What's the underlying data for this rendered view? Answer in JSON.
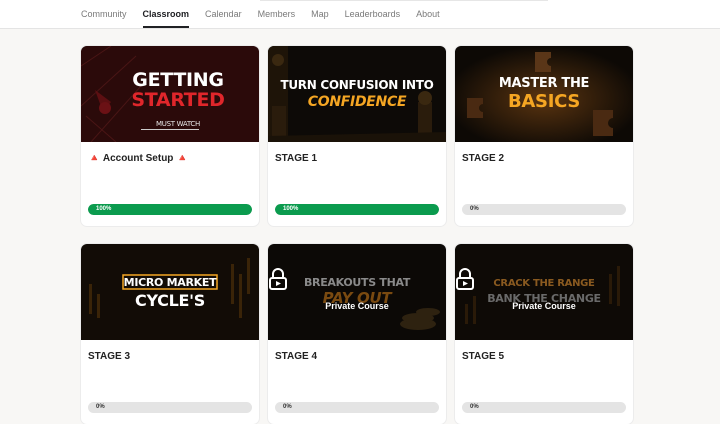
{
  "nav": {
    "items": [
      {
        "label": "Community",
        "active": false
      },
      {
        "label": "Classroom",
        "active": true
      },
      {
        "label": "Calendar",
        "active": false
      },
      {
        "label": "Members",
        "active": false
      },
      {
        "label": "Map",
        "active": false
      },
      {
        "label": "Leaderboards",
        "active": false
      },
      {
        "label": "About",
        "active": false
      }
    ]
  },
  "colors": {
    "progress_fill": "#0b9b4e",
    "progress_track": "#e4e4e4",
    "accent_orange": "#f5a623",
    "accent_red": "#e0262b"
  },
  "courses": [
    {
      "title": "🔺 Account Setup 🔺",
      "progress": 100,
      "progress_label": "100%",
      "locked": false,
      "thumb": {
        "line1": "GETTING",
        "line2": "STARTED",
        "sub": "MUST WATCH"
      }
    },
    {
      "title": "STAGE 1",
      "progress": 100,
      "progress_label": "100%",
      "locked": false,
      "thumb": {
        "line1": "TURN CONFUSION INTO",
        "line2": "CONFIDENCE"
      }
    },
    {
      "title": "STAGE 2",
      "progress": 0,
      "progress_label": "0%",
      "locked": false,
      "thumb": {
        "line1": "MASTER THE",
        "line2": "BASICS"
      }
    },
    {
      "title": "STAGE 3",
      "progress": 0,
      "progress_label": "0%",
      "locked": false,
      "thumb": {
        "line1": "MICRO MARKET",
        "line2": "CYCLE'S"
      }
    },
    {
      "title": "STAGE 4",
      "progress": 0,
      "progress_label": "0%",
      "locked": true,
      "private_label": "Private Course",
      "thumb": {
        "line1": "BREAKOUTS THAT",
        "line2": "PAY OUT"
      }
    },
    {
      "title": "STAGE 5",
      "progress": 0,
      "progress_label": "0%",
      "locked": true,
      "private_label": "Private Course",
      "thumb": {
        "line1": "CRACK THE RANGE",
        "line2": "BANK THE CHANGE"
      }
    }
  ]
}
